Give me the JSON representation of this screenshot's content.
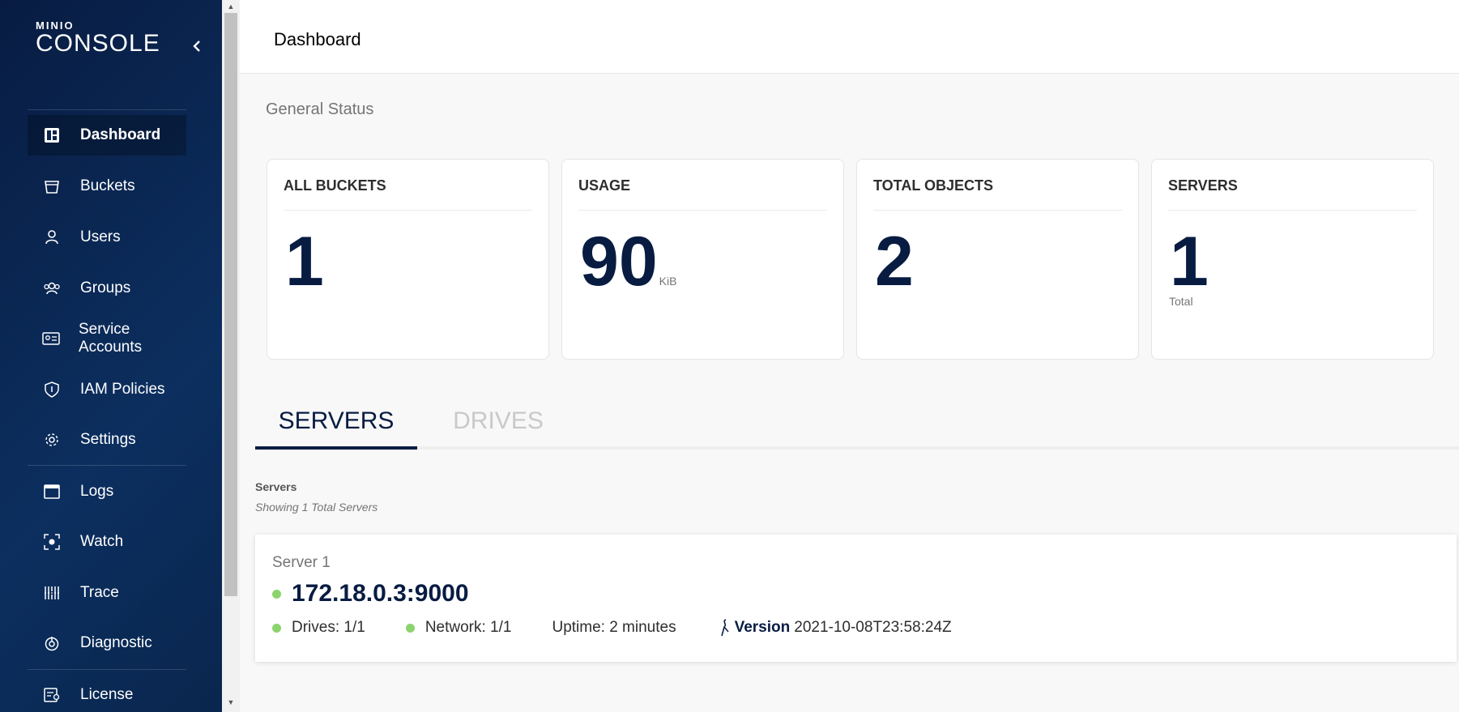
{
  "sidebar": {
    "brand": "MINIO",
    "product": "CONSOLE",
    "collapse_icon": "chevron-left-icon",
    "items": [
      {
        "label": "Dashboard",
        "icon": "dashboard-icon",
        "active": true
      },
      {
        "label": "Buckets",
        "icon": "bucket-icon"
      },
      {
        "label": "Users",
        "icon": "user-icon"
      },
      {
        "label": "Groups",
        "icon": "groups-icon"
      },
      {
        "label": "Service Accounts",
        "icon": "service-account-icon"
      },
      {
        "label": "IAM Policies",
        "icon": "shield-icon"
      },
      {
        "label": "Settings",
        "icon": "gear-icon"
      },
      {
        "label": "Logs",
        "icon": "logs-icon"
      },
      {
        "label": "Watch",
        "icon": "watch-icon"
      },
      {
        "label": "Trace",
        "icon": "trace-icon"
      },
      {
        "label": "Diagnostic",
        "icon": "diagnostic-icon"
      },
      {
        "label": "License",
        "icon": "license-icon"
      }
    ]
  },
  "header": {
    "title": "Dashboard"
  },
  "status": {
    "title": "General Status",
    "cards": [
      {
        "label": "ALL BUCKETS",
        "value": "1",
        "unit": "",
        "sub": ""
      },
      {
        "label": "USAGE",
        "value": "90",
        "unit": "KiB",
        "sub": ""
      },
      {
        "label": "TOTAL OBJECTS",
        "value": "2",
        "unit": "",
        "sub": ""
      },
      {
        "label": "SERVERS",
        "value": "1",
        "unit": "",
        "sub": "Total"
      }
    ]
  },
  "tabs": [
    {
      "label": "SERVERS",
      "active": true
    },
    {
      "label": "DRIVES",
      "active": false
    }
  ],
  "servers": {
    "heading": "Servers",
    "subheading": "Showing 1 Total Servers",
    "list": [
      {
        "name": "Server 1",
        "address": "172.18.0.3:9000",
        "drives": "Drives: 1/1",
        "network": "Network: 1/1",
        "uptime": "Uptime: 2 minutes",
        "version_label": "Version",
        "version": "2021-10-08T23:58:24Z"
      }
    ]
  },
  "colors": {
    "sidebar": "#081c42",
    "accent": "#081c42",
    "online": "#8bd46d"
  }
}
